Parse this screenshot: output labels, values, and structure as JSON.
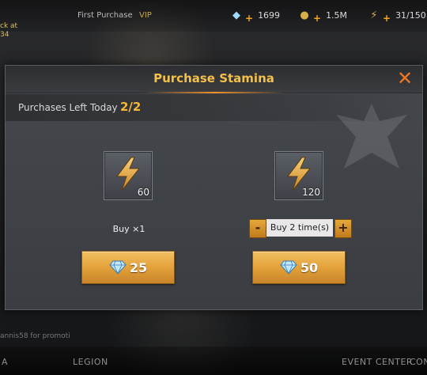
{
  "hud": {
    "menu_1": "First Purchase",
    "menu_2": "VIP",
    "side_note": "ck at\n34",
    "diamonds": "1699",
    "gold": "1.5M",
    "stamina": "31/150"
  },
  "dialog": {
    "title": "Purchase Stamina",
    "purchases_label": "Purchases Left Today",
    "purchases_value": "2/2"
  },
  "options": [
    {
      "quantity": "60",
      "buy_label": "Buy ×1",
      "price": "25"
    },
    {
      "quantity": "120",
      "buy_label": "Buy 2 time(s)",
      "price": "50",
      "minus": "-",
      "plus": "+"
    }
  ],
  "bottom": {
    "chat": "annis58 for promoti",
    "legion": "LEGION",
    "event_center": "EVENT CENTER",
    "con": "CON",
    "left": "A"
  },
  "colors": {
    "title": "#f5c04a",
    "accent": "#f07820",
    "button": "#e3a23a",
    "diamond": "#9fd9ff"
  },
  "icons": {
    "close": "close-icon",
    "stamina": "lightning-bolt-icon",
    "currency": "diamond-icon"
  }
}
